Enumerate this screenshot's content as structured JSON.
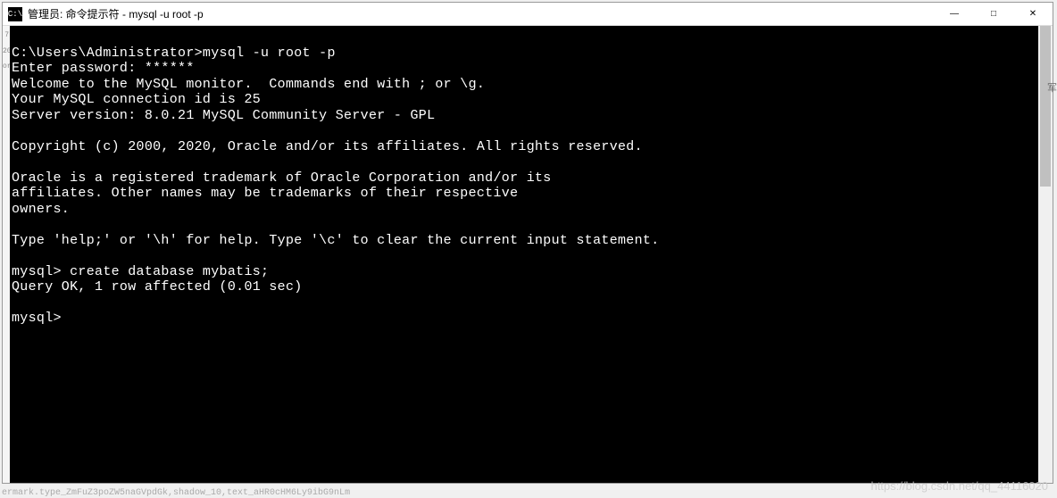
{
  "titlebar": {
    "icon_text": "C:\\",
    "title": "管理员: 命令提示符 - mysql  -u root -p"
  },
  "window_controls": {
    "minimize": "—",
    "maximize": "□",
    "close": "✕"
  },
  "terminal": {
    "lines": [
      "",
      "C:\\Users\\Administrator>mysql -u root -p",
      "Enter password: ******",
      "Welcome to the MySQL monitor.  Commands end with ; or \\g.",
      "Your MySQL connection id is 25",
      "Server version: 8.0.21 MySQL Community Server - GPL",
      "",
      "Copyright (c) 2000, 2020, Oracle and/or its affiliates. All rights reserved.",
      "",
      "Oracle is a registered trademark of Oracle Corporation and/or its",
      "affiliates. Other names may be trademarks of their respective",
      "owners.",
      "",
      "Type 'help;' or '\\h' for help. Type '\\c' to clear the current input statement.",
      "",
      "mysql> create database mybatis;",
      "Query OK, 1 row affected (0.01 sec)",
      "",
      "mysql>"
    ]
  },
  "watermark": "https://blog.csdn.net/qq_44116020",
  "line_labels": [
    "7",
    "",
    "",
    "",
    "",
    "",
    "",
    "",
    "",
    "",
    "",
    "",
    "",
    "",
    "",
    "20",
    "",
    "or"
  ],
  "bottom_garbage": "ermark.type_ZmFuZ3poZW5naGVpdGk,shadow_10,text_aHR0cHM6Ly9ibG9nLm"
}
